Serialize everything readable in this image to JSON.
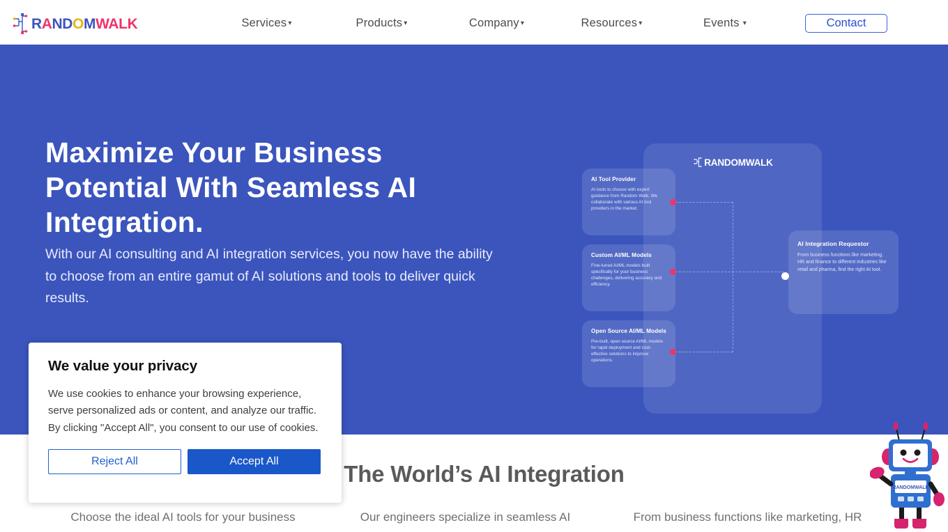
{
  "brand": {
    "name": "RANDOMWALK",
    "letters": [
      {
        "ch": "R",
        "color": "#3b55bd"
      },
      {
        "ch": "A",
        "color": "#f0336b"
      },
      {
        "ch": "N",
        "color": "#3b55bd"
      },
      {
        "ch": "D",
        "color": "#3b55bd"
      },
      {
        "ch": "O",
        "color": "#e8b413"
      },
      {
        "ch": "M",
        "color": "#3b55bd"
      },
      {
        "ch": "W",
        "color": "#f0336b"
      },
      {
        "ch": "A",
        "color": "#f0336b"
      },
      {
        "ch": "L",
        "color": "#f0336b"
      },
      {
        "ch": "K",
        "color": "#f0336b"
      }
    ],
    "accent_blue": "#3b55bd",
    "accent_pink": "#f0336b",
    "accent_yellow": "#e8b413"
  },
  "header": {
    "logo_name": "randomwalk-logo",
    "nav": [
      {
        "label": "Services",
        "caret": "▾"
      },
      {
        "label": "Products",
        "caret": "▾"
      },
      {
        "label": "Company",
        "caret": "▾"
      },
      {
        "label": "Resources",
        "caret": "▾"
      },
      {
        "label": "Events",
        "caret": "▾"
      }
    ],
    "contact_label": "Contact"
  },
  "hero": {
    "background_color": "#3b55bd",
    "title": "Maximize Your Business Potential With Seamless AI Integration.",
    "subtitle": "With our AI consulting and AI integration services, you now have the ability to choose from an entire gamut of AI solutions and tools to deliver quick results.",
    "diagram": {
      "panel_logo": "RANDOMWALK",
      "cards": [
        {
          "title": "AI Tool Provider",
          "body": "AI tools to choose with expert guidance from Random Walk. We collaborate with various AI tool providers in the market.",
          "dot_color": "#f0336b"
        },
        {
          "title": "Custom AI/ML Models",
          "body": "Fine-tuned AI/ML models built specifically for your business challenges, delivering accuracy and efficiency.",
          "dot_color": "#f0336b"
        },
        {
          "title": "Open Source AI/ML Models",
          "body": "Pre-built, open-source AI/ML models for rapid deployment and cost-effective solutions to improve operations.",
          "dot_color": "#f0336b"
        }
      ],
      "requestor": {
        "title": "AI Integration Requestor",
        "body": "From business functions like marketing, HR and finance to different industries like retail and pharma, find the right AI tool.",
        "dot_color": "#ffffff"
      }
    }
  },
  "lower": {
    "title": "g The World’s AI Integration",
    "columns": [
      "Choose the ideal AI tools for your business",
      "Our engineers specialize in seamless AI",
      "From business functions like marketing, HR"
    ]
  },
  "cookie": {
    "heading": "We value your privacy",
    "body": "We use cookies to enhance your browsing experience, serve personalized ads or content, and analyze our traffic. By clicking \"Accept All\", you consent to our use of cookies.",
    "reject_label": "Reject All",
    "accept_label": "Accept All",
    "accept_color": "#1a57c9",
    "reject_color": "#1f5fd0"
  },
  "mascot": {
    "name": "randomwalk-robot-mascot",
    "body_color": "#2f6fd0",
    "limb_color": "#d6246e"
  }
}
